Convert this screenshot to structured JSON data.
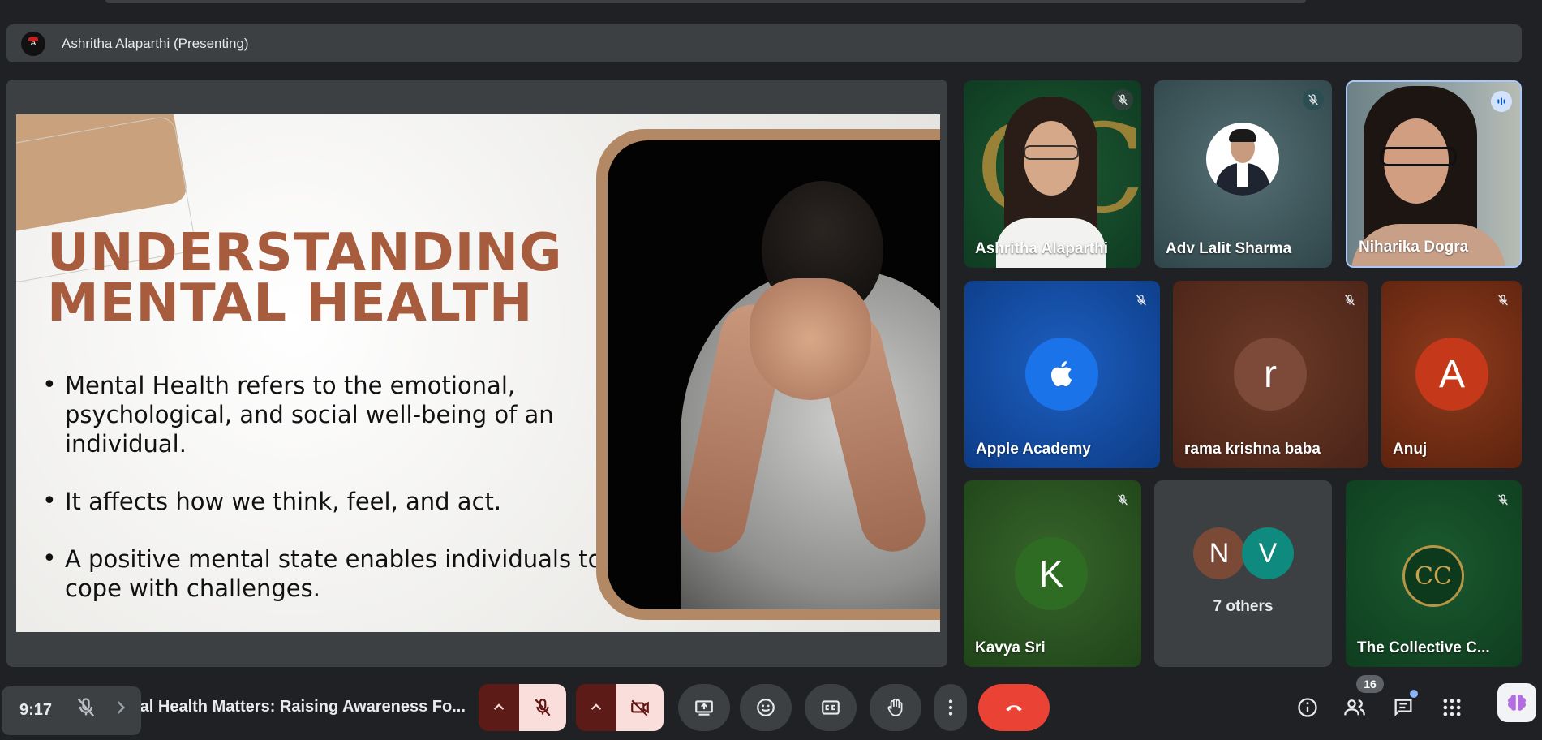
{
  "presenter_bar": {
    "name": "Ashritha Alaparthi (Presenting)"
  },
  "slide": {
    "title_line1": "UNDERSTANDING",
    "title_line2": "MENTAL HEALTH",
    "bullets": [
      "Mental Health refers to the emotional, psychological, and social well-being of an individual.",
      " It affects how we think, feel, and act.",
      "A positive mental state enables individuals to cope with challenges."
    ]
  },
  "participants": [
    {
      "name": "Ashritha Alaparthi",
      "muted": true
    },
    {
      "name": "Adv Lalit Sharma",
      "muted": true
    },
    {
      "name": "Niharika Dogra",
      "speaking": true
    },
    {
      "name": "Apple Academy",
      "muted": true
    },
    {
      "name": "rama krishna baba",
      "initial": "r",
      "muted": true
    },
    {
      "name": "Anuj",
      "initial": "A",
      "muted": true
    },
    {
      "name": "Kavya Sri",
      "initial": "K",
      "muted": true
    },
    {
      "name": "7 others",
      "initials": [
        "N",
        "V"
      ]
    },
    {
      "name": "The Collective C...",
      "muted": true
    }
  ],
  "bottom_bar": {
    "time": "9:17",
    "meeting_title": "tal Health Matters: Raising Awareness Fo...",
    "people_count": "16"
  },
  "colors": {
    "end_call": "#ea4335",
    "mic_off_bg": "#f9dedc",
    "toggle_dark_red": "#5c1b16",
    "speaking_border": "#a8c7fa"
  }
}
